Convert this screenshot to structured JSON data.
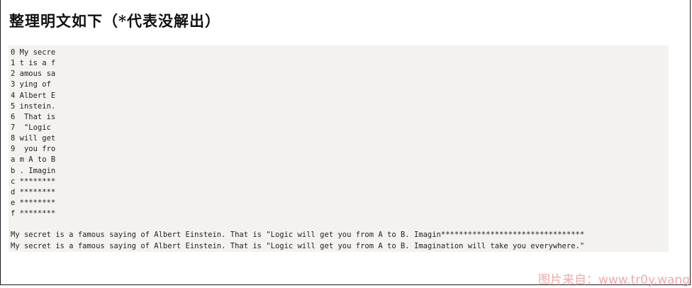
{
  "title": "整理明文如下（*代表没解出）",
  "rows": [
    "0 My secre",
    "1 t is a f",
    "2 amous sa",
    "3 ying of ",
    "4 Albert E",
    "5 instein.",
    "6  That is",
    "7  \"Logic ",
    "8 will get",
    "9  you fro",
    "a m A to B",
    "b . Imagin",
    "c ********",
    "d ********",
    "e ********",
    "f ********"
  ],
  "partial_line": "My secret is a famous saying of Albert Einstein. That is \"Logic will get you from A to B. Imagin********************************",
  "full_line": "My secret is a famous saying of Albert Einstein. That is \"Logic will get you from A to B. Imagination will take you everywhere.\"",
  "watermark": "图片来自：www.tr0y.wang"
}
